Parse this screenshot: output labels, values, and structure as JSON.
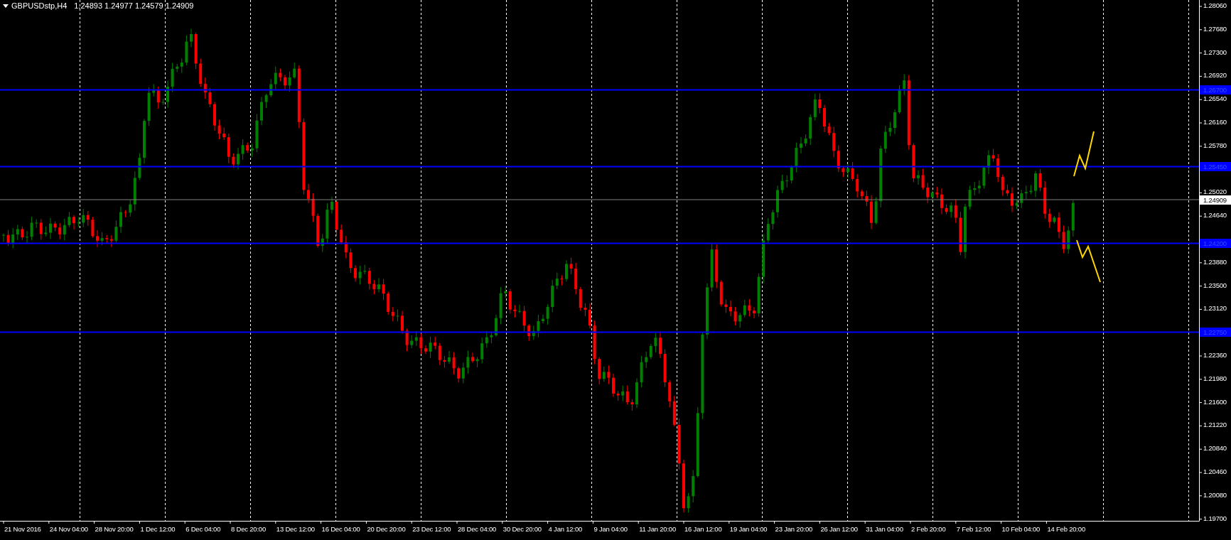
{
  "chart": {
    "symbol": "GBPUSDstp,H4",
    "quote": "1.24893 1.24977 1.24579 1.24909",
    "price_axis": [
      "1.28060",
      "1.27680",
      "1.27300",
      "1.26920",
      "1.26540",
      "1.26160",
      "1.25780",
      "1.25020",
      "1.24640",
      "1.23880",
      "1.23500",
      "1.23120",
      "1.22360",
      "1.21980",
      "1.21600",
      "1.21220",
      "1.20840",
      "1.20460",
      "1.20080",
      "1.19700"
    ],
    "time_axis": [
      "21 Nov 2016",
      "24 Nov 04:00",
      "28 Nov 20:00",
      "1 Dec 12:00",
      "6 Dec 04:00",
      "8 Dec 20:00",
      "13 Dec 12:00",
      "16 Dec 04:00",
      "20 Dec 20:00",
      "23 Dec 12:00",
      "28 Dec 04:00",
      "30 Dec 20:00",
      "4 Jan 12:00",
      "9 Jan 04:00",
      "11 Jan 20:00",
      "16 Jan 12:00",
      "19 Jan 04:00",
      "23 Jan 20:00",
      "26 Jan 12:00",
      "31 Jan 04:00",
      "2 Feb 20:00",
      "7 Feb 12:00",
      "10 Feb 04:00",
      "14 Feb 20:00"
    ],
    "levels": [
      {
        "label": "1.26700"
      },
      {
        "label": "1.25450"
      },
      {
        "label": "1.24200"
      },
      {
        "label": "1.22750"
      }
    ],
    "current_price": "1.24909"
  }
}
